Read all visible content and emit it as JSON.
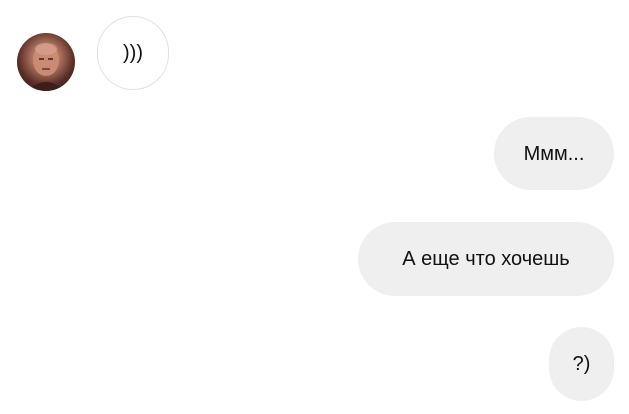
{
  "chat": {
    "contact_avatar": "avatar",
    "incoming": [
      {
        "text": ")))"
      }
    ],
    "outgoing": [
      {
        "text": "Ммм..."
      },
      {
        "text": "А еще что хочешь"
      },
      {
        "text": "?)"
      }
    ],
    "colors": {
      "background": "#ffffff",
      "outgoing_bubble": "#efefef",
      "incoming_border": "#e2e2e2",
      "text": "#111111"
    }
  }
}
